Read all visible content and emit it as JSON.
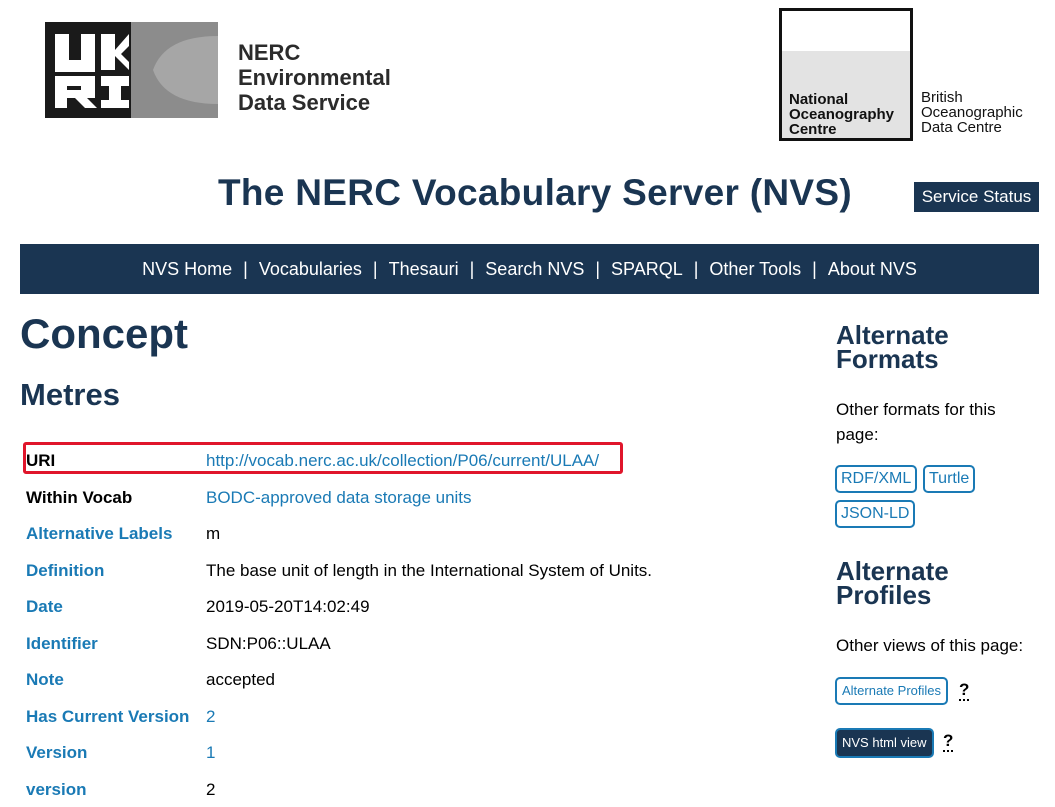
{
  "header": {
    "ukri_logo_text": "UKRI",
    "nerc_text": "NERC\nEnvironmental\nData Service",
    "noc_text": "National\nOceanography\nCentre",
    "bodc_text": "British\nOceanographic\nData Centre",
    "site_title": "The NERC Vocabulary Server (NVS)",
    "service_status": "Service Status"
  },
  "nav": {
    "items": [
      "NVS Home",
      "Vocabularies",
      "Thesauri",
      "Search NVS",
      "SPARQL",
      "Other Tools",
      "About NVS"
    ],
    "separator": "|"
  },
  "main": {
    "title": "Concept",
    "concept_label": "Metres",
    "properties": [
      {
        "key": "URI",
        "value": "http://vocab.nerc.ac.uk/collection/P06/current/ULAA/"
      },
      {
        "key": "Within Vocab",
        "value": "BODC-approved data storage units"
      },
      {
        "key": "Alternative Labels",
        "value": "m"
      },
      {
        "key": "Definition",
        "value": "The base unit of length in the International System of Units."
      },
      {
        "key": "Date",
        "value": "2019-05-20T14:02:49"
      },
      {
        "key": "Identifier",
        "value": "SDN:P06::ULAA"
      },
      {
        "key": "Note",
        "value": "accepted"
      },
      {
        "key": "Has Current Version",
        "value": "2"
      },
      {
        "key": "Version",
        "value": "1"
      },
      {
        "key": "version",
        "value": "2"
      }
    ]
  },
  "sidebar": {
    "alt_formats_heading": "Alternate Formats",
    "alt_formats_text": "Other formats for this page:",
    "formats": [
      "RDF/XML",
      "Turtle",
      "JSON-LD"
    ],
    "alt_profiles_heading": "Alternate Profiles",
    "alt_profiles_text": "Other views of this page:",
    "alt_profiles_button": "Alternate Profiles",
    "nvs_html_button": "NVS html view",
    "help_mark": "?"
  },
  "colors": {
    "navy": "#1a3552",
    "link": "#1a7ab5",
    "highlight": "#e0162b"
  }
}
